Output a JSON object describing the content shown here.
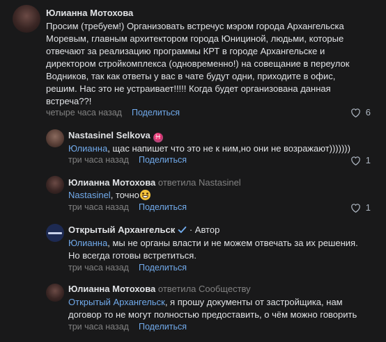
{
  "comments": [
    {
      "author": "Юлианна Мотохова",
      "text_lines": [
        "Просим (требуем!) Организовать встречус мэром города Архангельска",
        "Моревым, главным архитектором города Юнициной, людьми, которые",
        "отвечают за реализацию программы КРТ в городе Архангельске и",
        "директором стройкомплекса (одновременно!) на совещание в переулок",
        "Водников, так как ответы у вас в чате будут одни, приходите в офис,",
        "решим. Нас это не устраивает!!!!! Когда будет организована данная",
        "встреча??!"
      ],
      "time": "четыре часа назад",
      "share": "Поделиться",
      "likes": "6"
    },
    {
      "author": "Nastasinel Selkova",
      "zodiac": "♓",
      "mention": "Юлианна",
      "text": ", щас напишет что это не к ним,но они не возражают)))))))",
      "time": "три часа назад",
      "share": "Поделиться",
      "likes": "1"
    },
    {
      "author": "Юлианна Мотохова",
      "reply_to": "ответила Nastasinel",
      "mention": "Nastasinel",
      "text": ", точно",
      "time": "три часа назад",
      "share": "Поделиться",
      "likes": "1"
    },
    {
      "author": "Открытый Архангельск",
      "badge": "· Автор",
      "mention": "Юлианна",
      "text_line1": ", мы не органы власти и не можем отвечать за их решения.",
      "text_line2": "Но всегда готовы встретиться.",
      "time": "три часа назад",
      "share": "Поделиться"
    },
    {
      "author": "Юлианна Мотохова",
      "reply_to": "ответила Сообществу",
      "mention": "Открытый Архангельск",
      "text_line1": ", я прошу документы от застройщика, нам",
      "text_line2": "договор то не могут полностью предоставить, о чём можно говорить",
      "time": "три часа назад",
      "share": "Поделиться"
    }
  ]
}
